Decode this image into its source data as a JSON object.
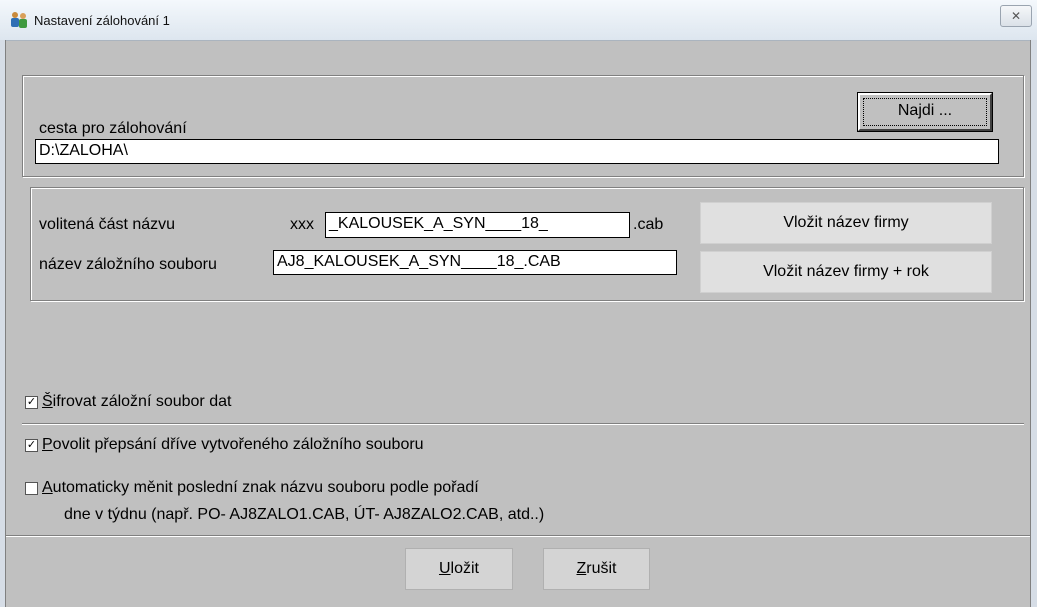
{
  "window": {
    "title": "Nastavení zálohování 1",
    "close_glyph": "✕"
  },
  "path_section": {
    "label": "cesta pro zálohování",
    "value": "D:\\ZALOHA\\",
    "find_button": "Najdi ..."
  },
  "name_section": {
    "optional_label": "volitená část názvu",
    "prefix": "xxx",
    "optional_value": "_KALOUSEK_A_SYN____18_",
    "suffix": ".cab",
    "file_label": "název záložního souboru",
    "file_value": "AJ8_KALOUSEK_A_SYN____18_.CAB",
    "insert_company_button": "Vložit název firmy",
    "insert_company_year_button": "Vložit název firmy + rok"
  },
  "options": {
    "encrypt": {
      "checked": true,
      "accel": "Š",
      "rest": "ifrovat záložní soubor dat"
    },
    "overwrite": {
      "checked": true,
      "accel": "P",
      "rest": "ovolit přepsání dříve vytvořeného záložního souboru"
    },
    "auto_change": {
      "checked": false,
      "accel": "A",
      "rest": "utomaticky měnit poslední znak názvu souboru podle pořadí",
      "line2": "dne v týdnu (např. PO- AJ8ZALO1.CAB, ÚT- AJ8ZALO2.CAB, atd..)"
    }
  },
  "footer": {
    "save_accel": "U",
    "save_rest": "ložit",
    "cancel_accel": "Z",
    "cancel_rest": "rušit"
  },
  "check_glyph": "✓"
}
